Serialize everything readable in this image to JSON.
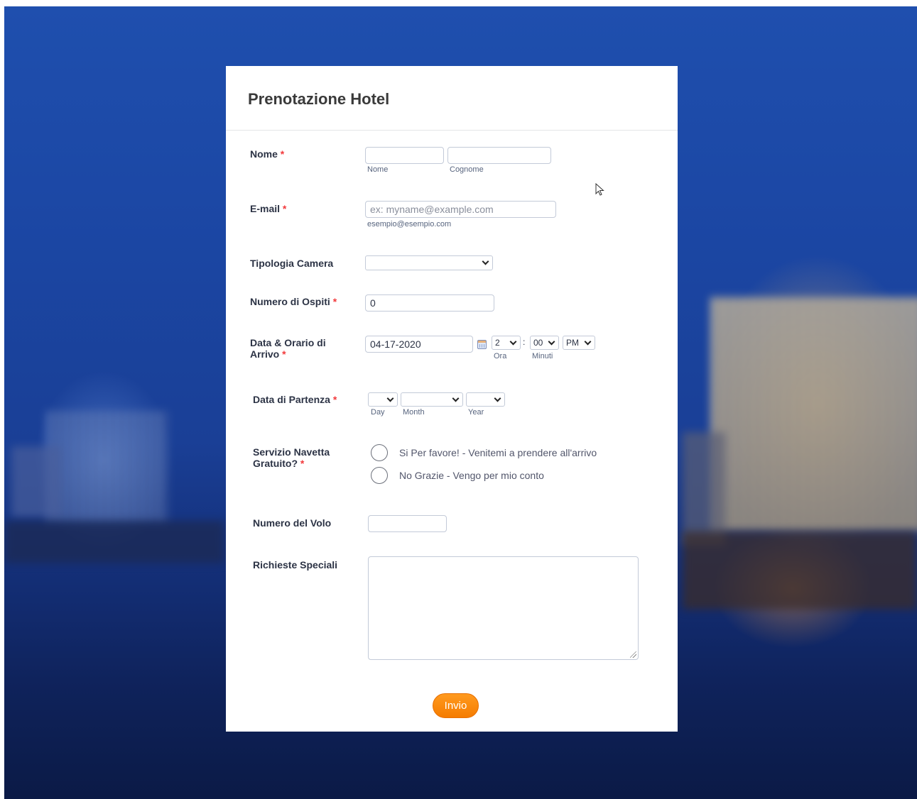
{
  "form": {
    "title": "Prenotazione Hotel",
    "required_marker": "*",
    "nome": {
      "label": "Nome",
      "first_sublabel": "Nome",
      "last_sublabel": "Cognome",
      "first_value": "",
      "last_value": ""
    },
    "email": {
      "label": "E-mail",
      "placeholder": "ex: myname@example.com",
      "sublabel": "esempio@esempio.com",
      "value": ""
    },
    "room_type": {
      "label": "Tipologia Camera",
      "selected": ""
    },
    "guests": {
      "label": "Numero di Ospiti",
      "value": "0"
    },
    "arrival": {
      "label": "Data & Orario di Arrivo",
      "date_value": "04-17-2020",
      "hour": "2",
      "hour_sublabel": "Ora",
      "time_separator": ":",
      "minute": "00",
      "minute_sublabel": "Minuti",
      "ampm": "PM"
    },
    "departure": {
      "label": "Data di Partenza",
      "day_sublabel": "Day",
      "month_sublabel": "Month",
      "year_sublabel": "Year",
      "day": "",
      "month": "",
      "year": ""
    },
    "shuttle": {
      "label": "Servizio Navetta Gratuito?",
      "options": [
        "Si Per favore! - Venitemi a prendere all'arrivo",
        "No Grazie - Vengo per mio conto"
      ]
    },
    "flight": {
      "label": "Numero del Volo",
      "value": ""
    },
    "special": {
      "label": "Richieste Speciali",
      "value": ""
    },
    "submit_label": "Invio"
  },
  "colors": {
    "accent": "#f57c00",
    "required": "#f23a3c",
    "label_text": "#2c3345"
  }
}
